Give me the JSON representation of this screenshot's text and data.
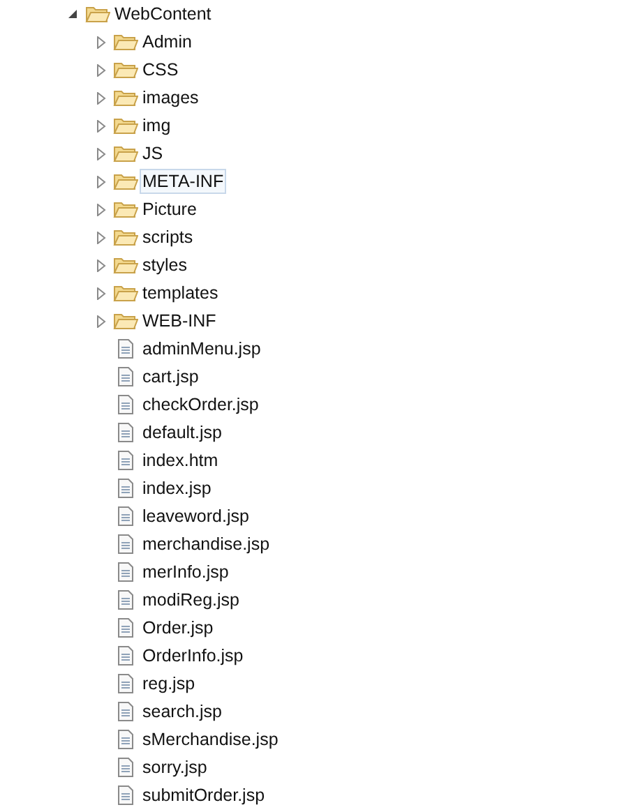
{
  "tree": [
    {
      "label": "WebContent",
      "kind": "folder",
      "expanded": true,
      "selected": false,
      "children": [
        {
          "label": "Admin",
          "kind": "folder",
          "expanded": false,
          "selected": false
        },
        {
          "label": "CSS",
          "kind": "folder",
          "expanded": false,
          "selected": false
        },
        {
          "label": "images",
          "kind": "folder",
          "expanded": false,
          "selected": false
        },
        {
          "label": "img",
          "kind": "folder",
          "expanded": false,
          "selected": false
        },
        {
          "label": "JS",
          "kind": "folder",
          "expanded": false,
          "selected": false
        },
        {
          "label": "META-INF",
          "kind": "folder",
          "expanded": false,
          "selected": true
        },
        {
          "label": "Picture",
          "kind": "folder",
          "expanded": false,
          "selected": false
        },
        {
          "label": "scripts",
          "kind": "folder",
          "expanded": false,
          "selected": false
        },
        {
          "label": "styles",
          "kind": "folder",
          "expanded": false,
          "selected": false
        },
        {
          "label": "templates",
          "kind": "folder",
          "expanded": false,
          "selected": false
        },
        {
          "label": "WEB-INF",
          "kind": "folder",
          "expanded": false,
          "selected": false
        },
        {
          "label": "adminMenu.jsp",
          "kind": "file",
          "selected": false
        },
        {
          "label": "cart.jsp",
          "kind": "file",
          "selected": false
        },
        {
          "label": "checkOrder.jsp",
          "kind": "file",
          "selected": false
        },
        {
          "label": "default.jsp",
          "kind": "file",
          "selected": false
        },
        {
          "label": "index.htm",
          "kind": "file",
          "selected": false
        },
        {
          "label": "index.jsp",
          "kind": "file",
          "selected": false
        },
        {
          "label": "leaveword.jsp",
          "kind": "file",
          "selected": false
        },
        {
          "label": "merchandise.jsp",
          "kind": "file",
          "selected": false
        },
        {
          "label": "merInfo.jsp",
          "kind": "file",
          "selected": false
        },
        {
          "label": "modiReg.jsp",
          "kind": "file",
          "selected": false
        },
        {
          "label": "Order.jsp",
          "kind": "file",
          "selected": false
        },
        {
          "label": "OrderInfo.jsp",
          "kind": "file",
          "selected": false
        },
        {
          "label": "reg.jsp",
          "kind": "file",
          "selected": false
        },
        {
          "label": "search.jsp",
          "kind": "file",
          "selected": false
        },
        {
          "label": "sMerchandise.jsp",
          "kind": "file",
          "selected": false
        },
        {
          "label": "sorry.jsp",
          "kind": "file",
          "selected": false
        },
        {
          "label": "submitOrder.jsp",
          "kind": "file",
          "selected": false
        }
      ]
    }
  ]
}
